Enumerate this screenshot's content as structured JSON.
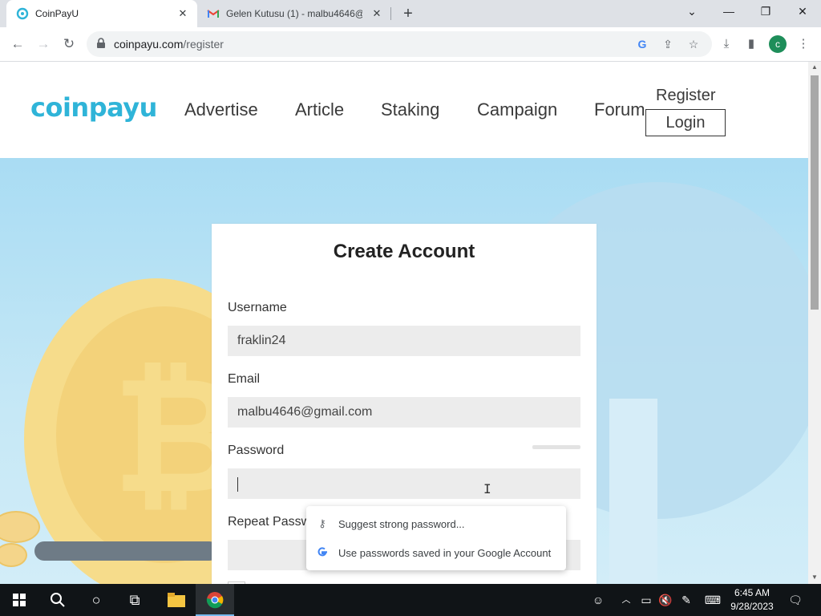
{
  "browser": {
    "tabs": [
      {
        "title": "CoinPayU",
        "active": true
      },
      {
        "title": "Gelen Kutusu (1) - malbu4646@",
        "active": false
      }
    ],
    "url": {
      "domain": "coinpayu.com",
      "path": "/register"
    },
    "profile_initial": "c",
    "window_controls": {
      "minimize": "—",
      "restore": "❐",
      "close": "✕",
      "tab_search": "⌄"
    }
  },
  "site": {
    "logo": "coinpayu",
    "nav": [
      {
        "label": "Advertise"
      },
      {
        "label": "Article"
      },
      {
        "label": "Staking"
      },
      {
        "label": "Campaign"
      },
      {
        "label": "Forum"
      }
    ],
    "register_label": "Register",
    "login_label": "Login"
  },
  "form": {
    "title": "Create Account",
    "username": {
      "label": "Username",
      "value": "fraklin24"
    },
    "email": {
      "label": "Email",
      "value": "malbu4646@gmail.com"
    },
    "password": {
      "label": "Password",
      "value": ""
    },
    "repeat_password": {
      "label": "Repeat Passw",
      "value": ""
    }
  },
  "autofill_popup": {
    "items": [
      {
        "icon": "key-icon",
        "label": "Suggest strong password..."
      },
      {
        "icon": "google-icon",
        "label": "Use passwords saved in your Google Account"
      }
    ]
  },
  "taskbar": {
    "time": "6:45 AM",
    "date": "9/28/2023"
  },
  "colors": {
    "brand": "#2fb4d8",
    "hero_bg": "#a9dcf3",
    "coin": "#f6dc8b",
    "taskbar": "#101417"
  }
}
